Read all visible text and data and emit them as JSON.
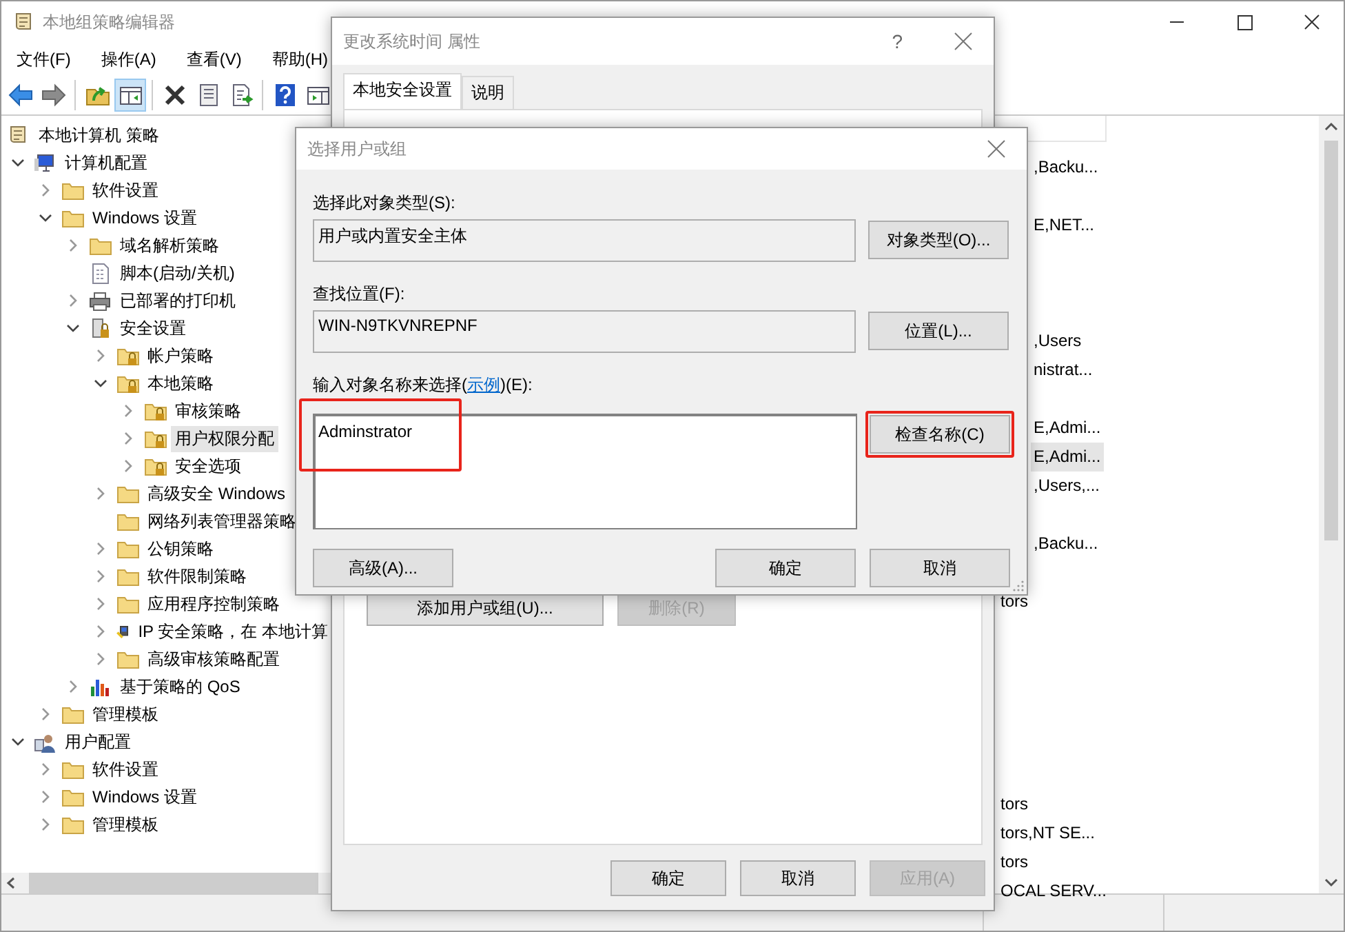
{
  "main_window": {
    "title": "本地组策略编辑器",
    "menu": [
      "文件(F)",
      "操作(A)",
      "查看(V)",
      "帮助(H)"
    ],
    "toolbar": [
      {
        "kind": "back",
        "pressed": false,
        "disabled": false
      },
      {
        "kind": "forward",
        "pressed": false,
        "disabled": true
      },
      {
        "kind": "separator"
      },
      {
        "kind": "up",
        "pressed": false,
        "disabled": false
      },
      {
        "kind": "tree",
        "pressed": true,
        "disabled": false
      },
      {
        "kind": "separator"
      },
      {
        "kind": "delete",
        "pressed": false,
        "disabled": false
      },
      {
        "kind": "properties",
        "pressed": false,
        "disabled": false
      },
      {
        "kind": "export",
        "pressed": false,
        "disabled": false
      },
      {
        "kind": "separator"
      },
      {
        "kind": "help",
        "pressed": false,
        "disabled": false
      },
      {
        "kind": "pane",
        "pressed": false,
        "disabled": false
      }
    ],
    "tree": [
      {
        "label": "本地计算机 策略",
        "kind": "policy",
        "selected": false,
        "children": [
          {
            "label": "计算机配置",
            "kind": "computer",
            "expandable": true,
            "expanded": true,
            "selected": false,
            "children": [
              {
                "label": "软件设置",
                "kind": "folder",
                "expandable": true,
                "expanded": false,
                "selected": false
              },
              {
                "label": "Windows 设置",
                "kind": "folder",
                "expandable": true,
                "expanded": true,
                "selected": false,
                "children": [
                  {
                    "label": "域名解析策略",
                    "kind": "folder",
                    "expandable": true,
                    "expanded": false,
                    "selected": false
                  },
                  {
                    "label": "脚本(启动/关机)",
                    "kind": "script",
                    "expandable": false,
                    "expanded": false,
                    "selected": false
                  },
                  {
                    "label": "已部署的打印机",
                    "kind": "printer",
                    "expandable": true,
                    "expanded": false,
                    "selected": false
                  },
                  {
                    "label": "安全设置",
                    "kind": "security",
                    "expandable": true,
                    "expanded": true,
                    "selected": false,
                    "children": [
                      {
                        "label": "帐户策略",
                        "kind": "lock-folder",
                        "expandable": true,
                        "expanded": false,
                        "selected": false
                      },
                      {
                        "label": "本地策略",
                        "kind": "lock-folder",
                        "expandable": true,
                        "expanded": true,
                        "selected": false,
                        "children": [
                          {
                            "label": "审核策略",
                            "kind": "lock-folder",
                            "expandable": true,
                            "expanded": false,
                            "selected": false
                          },
                          {
                            "label": "用户权限分配",
                            "kind": "lock-folder",
                            "expandable": true,
                            "expanded": false,
                            "selected": true
                          },
                          {
                            "label": "安全选项",
                            "kind": "lock-folder",
                            "expandable": true,
                            "expanded": false,
                            "selected": false
                          }
                        ]
                      },
                      {
                        "label": "高级安全 Windows",
                        "kind": "folder",
                        "expandable": true,
                        "expanded": false,
                        "selected": false
                      },
                      {
                        "label": "网络列表管理器策略",
                        "kind": "folder",
                        "expandable": false,
                        "expanded": false,
                        "selected": false
                      },
                      {
                        "label": "公钥策略",
                        "kind": "folder",
                        "expandable": true,
                        "expanded": false,
                        "selected": false
                      },
                      {
                        "label": "软件限制策略",
                        "kind": "folder",
                        "expandable": true,
                        "expanded": false,
                        "selected": false
                      },
                      {
                        "label": "应用程序控制策略",
                        "kind": "folder",
                        "expandable": true,
                        "expanded": false,
                        "selected": false
                      },
                      {
                        "label": "IP 安全策略，在 本地计算",
                        "kind": "ip",
                        "expandable": true,
                        "expanded": false,
                        "selected": false
                      },
                      {
                        "label": "高级审核策略配置",
                        "kind": "folder",
                        "expandable": true,
                        "expanded": false,
                        "selected": false
                      }
                    ]
                  },
                  {
                    "label": "基于策略的 QoS",
                    "kind": "qos",
                    "expandable": true,
                    "expanded": false,
                    "selected": false
                  }
                ]
              },
              {
                "label": "管理模板",
                "kind": "folder",
                "expandable": true,
                "expanded": false,
                "selected": false
              }
            ]
          },
          {
            "label": "用户配置",
            "kind": "user",
            "expandable": true,
            "expanded": true,
            "selected": false,
            "children": [
              {
                "label": "软件设置",
                "kind": "folder",
                "expandable": true,
                "expanded": false,
                "selected": false
              },
              {
                "label": "Windows 设置",
                "kind": "folder",
                "expandable": true,
                "expanded": false,
                "selected": false
              },
              {
                "label": "管理模板",
                "kind": "folder",
                "expandable": true,
                "expanded": false,
                "selected": false
              }
            ]
          }
        ]
      }
    ],
    "list_rows": [
      {
        "text": ",Backu...",
        "selected": false
      },
      {
        "text": "E,NET...",
        "selected": false
      },
      {
        "text": ",Users",
        "selected": false
      },
      {
        "text": "nistrat...",
        "selected": false
      },
      {
        "text": "E,Admi...",
        "selected": false
      },
      {
        "text": "E,Admi...",
        "selected": true
      },
      {
        "text": ",Users,...",
        "selected": false
      },
      {
        "text": ",Backu...",
        "selected": false
      },
      {
        "text": "tors",
        "selected": false
      },
      {
        "text": "tors",
        "selected": false
      },
      {
        "text": "tors,NT SE...",
        "selected": false
      },
      {
        "text": "tors",
        "selected": false
      },
      {
        "text": "OCAL SERV...",
        "selected": false
      }
    ]
  },
  "properties_dialog": {
    "title": "更改系统时间 属性",
    "help": "?",
    "tabs": [
      {
        "label": "本地安全设置",
        "selected": true
      },
      {
        "label": "说明",
        "selected": false
      }
    ],
    "buttons": [
      {
        "label": "添加用户或组(U)...",
        "disabled": false
      },
      {
        "label": "删除(R)",
        "disabled": true
      }
    ],
    "footer_buttons": [
      {
        "label": "确定",
        "disabled": false
      },
      {
        "label": "取消",
        "disabled": false
      },
      {
        "label": "应用(A)",
        "disabled": true
      }
    ]
  },
  "select_dialog": {
    "title": "选择用户或组",
    "object_type": {
      "label": "选择此对象类型(S):",
      "value": "用户或内置安全主体",
      "button": "对象类型(O)..."
    },
    "location": {
      "label": "查找位置(F):",
      "value": "WIN-N9TKVNREPNF",
      "button": "位置(L)..."
    },
    "names": {
      "label_before": "输入对象名称来选择(",
      "link": "示例",
      "label_after": ")(E):",
      "value": "Adminstrator",
      "highlighted": true,
      "button": "检查名称(C)",
      "button_highlighted": true
    },
    "buttons": [
      "高级(A)...",
      "确定",
      "取消"
    ]
  }
}
